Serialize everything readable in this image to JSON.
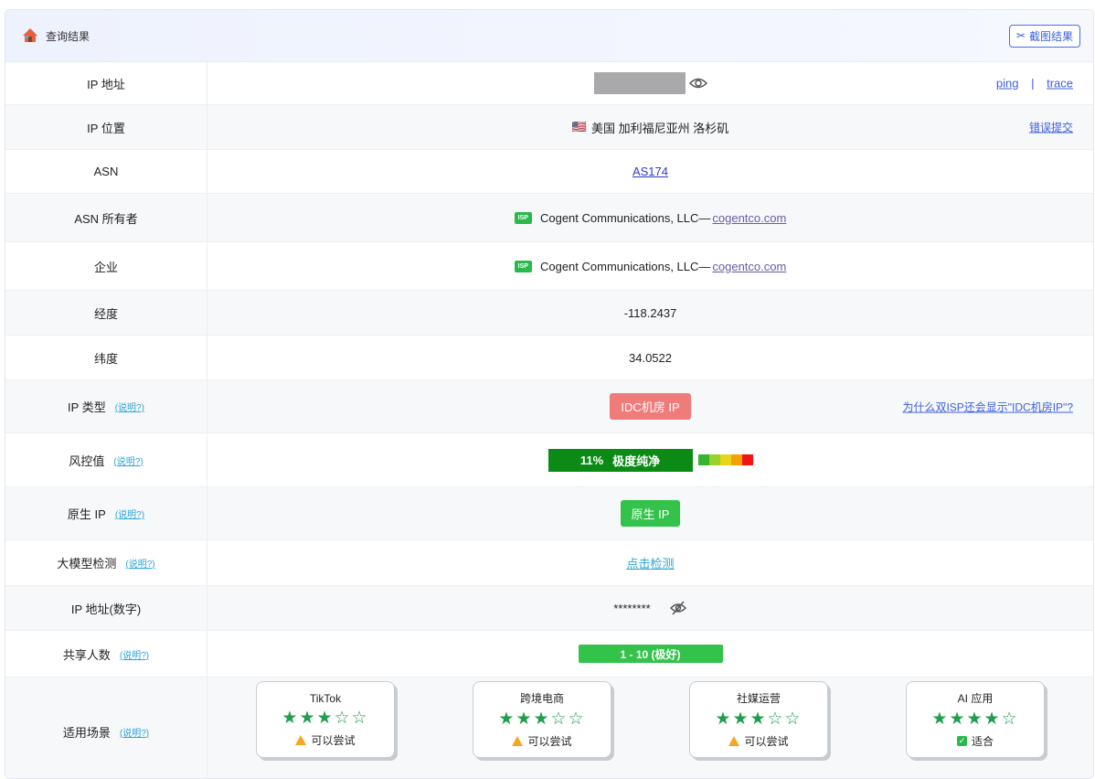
{
  "header": {
    "title": "查询结果",
    "screenshot_button": "截图结果"
  },
  "ip": {
    "label": "IP 地址",
    "ping": "ping",
    "separator": "|",
    "trace": "trace"
  },
  "location": {
    "label": "IP 位置",
    "flag": "🇺🇸",
    "value": "美国 加利福尼亚州 洛杉矶",
    "report": "错误提交"
  },
  "asn": {
    "label": "ASN",
    "value": "AS174"
  },
  "asn_owner": {
    "label": "ASN 所有者",
    "badge": "ISP",
    "name": "Cogent Communications, LLC—",
    "domain": "cogentco.com"
  },
  "company": {
    "label": "企业",
    "badge": "ISP",
    "name": "Cogent Communications, LLC—",
    "domain": "cogentco.com"
  },
  "longitude": {
    "label": "经度",
    "value": "-118.2437"
  },
  "latitude": {
    "label": "纬度",
    "value": "34.0522"
  },
  "ip_type": {
    "label": "IP 类型",
    "note": "(说明?)",
    "value": "IDC机房 IP",
    "question": "为什么双ISP还会显示\"IDC机房IP\"?"
  },
  "risk": {
    "label": "风控值",
    "note": "(说明?)",
    "percent": "11%",
    "text": "极度纯净",
    "scale_colors": [
      "#35b52e",
      "#9ad12a",
      "#e6d51b",
      "#f5a100",
      "#f21313"
    ]
  },
  "native": {
    "label": "原生 IP",
    "note": "(说明?)",
    "value": "原生 IP"
  },
  "llm": {
    "label": "大模型检测",
    "note": "(说明?)",
    "value": "点击检测"
  },
  "ip_numeric": {
    "label": "IP 地址(数字)",
    "value": "********"
  },
  "share": {
    "label": "共享人数",
    "note": "(说明?)",
    "value": "1 - 10 (极好)"
  },
  "scenes": {
    "label": "适用场景",
    "note": "(说明?)",
    "items": [
      {
        "name": "TikTok",
        "stars": "★★★☆☆",
        "verdict": "可以尝试",
        "icon": "warning-icon"
      },
      {
        "name": "跨境电商",
        "stars": "★★★☆☆",
        "verdict": "可以尝试",
        "icon": "warning-icon"
      },
      {
        "name": "社媒运营",
        "stars": "★★★☆☆",
        "verdict": "可以尝试",
        "icon": "warning-icon"
      },
      {
        "name": "AI 应用",
        "stars": "★★★★☆",
        "verdict": "适合",
        "icon": "check-icon"
      }
    ]
  },
  "colors": {
    "accent": "#3c5fe0",
    "good": "#33c24a",
    "bad": "#ef7b7b",
    "star": "#1f9e4c"
  }
}
